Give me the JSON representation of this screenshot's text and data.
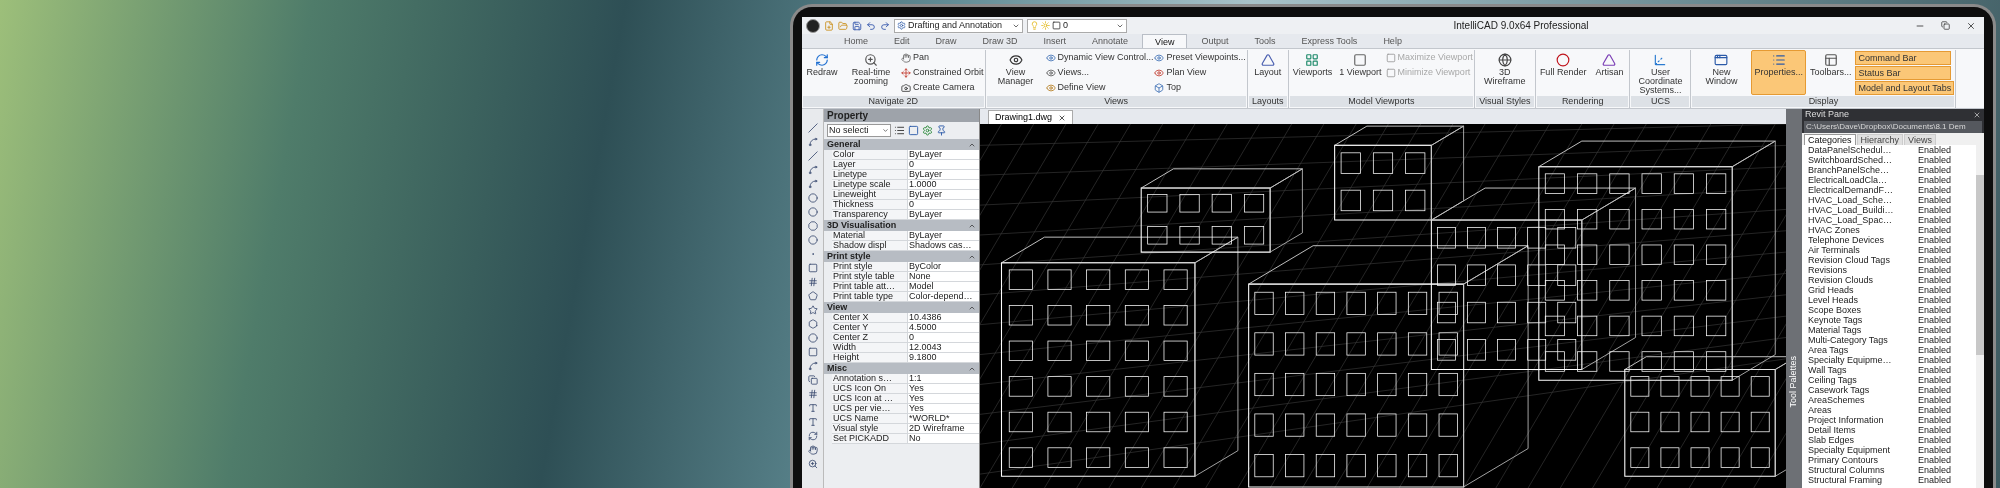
{
  "title_bar": {
    "workspace": "Drafting and Annotation",
    "layer": "0",
    "title": "IntelliCAD 9.0x64 Professional"
  },
  "menu_tabs": [
    {
      "label": "Home",
      "selected": false
    },
    {
      "label": "Edit",
      "selected": false
    },
    {
      "label": "Draw",
      "selected": false
    },
    {
      "label": "Draw 3D",
      "selected": false
    },
    {
      "label": "Insert",
      "selected": false
    },
    {
      "label": "Annotate",
      "selected": false
    },
    {
      "label": "View",
      "selected": true
    },
    {
      "label": "Output",
      "selected": false
    },
    {
      "label": "Tools",
      "selected": false
    },
    {
      "label": "Express Tools",
      "selected": false
    },
    {
      "label": "Help",
      "selected": false
    }
  ],
  "ribbon_groups": [
    {
      "title": "Navigate 2D",
      "items": [
        {
          "kind": "large",
          "label": "Redraw"
        },
        {
          "kind": "large",
          "label": "Real-time zooming"
        },
        {
          "kind": "small",
          "label": "Pan"
        },
        {
          "kind": "small",
          "label": "Constrained Orbit"
        },
        {
          "kind": "small",
          "label": "Create Camera"
        }
      ]
    },
    {
      "title": "Views",
      "items": [
        {
          "kind": "large",
          "label": "View Manager"
        },
        {
          "kind": "small",
          "label": "Dynamic View Control..."
        },
        {
          "kind": "small",
          "label": "Views..."
        },
        {
          "kind": "small",
          "label": "Define View"
        },
        {
          "kind": "small",
          "label": "Preset Viewpoints..."
        },
        {
          "kind": "small",
          "label": "Plan View"
        },
        {
          "kind": "small",
          "label": "Top"
        }
      ]
    },
    {
      "title": "Layouts",
      "items": [
        {
          "kind": "large",
          "label": "Layout"
        }
      ]
    },
    {
      "title": "Model Viewports",
      "items": [
        {
          "kind": "large",
          "label": "Viewports"
        },
        {
          "kind": "large",
          "label": "1 Viewport"
        },
        {
          "kind": "small",
          "label": "Maximize Viewport",
          "disabled": true
        },
        {
          "kind": "small",
          "label": "Minimize Viewport",
          "disabled": true
        }
      ]
    },
    {
      "title": "Visual Styles",
      "items": [
        {
          "kind": "large",
          "label": "3D Wireframe"
        }
      ]
    },
    {
      "title": "Rendering",
      "items": [
        {
          "kind": "large",
          "label": "Full Render"
        },
        {
          "kind": "large",
          "label": "Artisan"
        }
      ]
    },
    {
      "title": "UCS",
      "items": [
        {
          "kind": "large",
          "label": "User Coordinate Systems..."
        }
      ]
    },
    {
      "title": "Display",
      "items": [
        {
          "kind": "large",
          "label": "New Window",
          "selected": false
        },
        {
          "kind": "large",
          "label": "Properties...",
          "selected": true
        },
        {
          "kind": "large",
          "label": "Toolbars...",
          "selected": false
        },
        {
          "kind": "toggle",
          "label": "Command Bar",
          "on": true
        },
        {
          "kind": "toggle",
          "label": "Status Bar",
          "on": true
        },
        {
          "kind": "toggle",
          "label": "Model and Layout Tabs",
          "on": true
        }
      ]
    }
  ],
  "document_tab": "Drawing1.dwg",
  "property_panel": {
    "title": "Property",
    "selection": "No selecti",
    "sections": [
      {
        "title": "General",
        "rows": [
          [
            "Color",
            "ByLayer"
          ],
          [
            "Layer",
            "0"
          ],
          [
            "Linetype",
            "ByLayer"
          ],
          [
            "Linetype scale",
            "1.0000"
          ],
          [
            "Lineweight",
            "ByLayer"
          ],
          [
            "Thickness",
            "0"
          ],
          [
            "Transparency",
            "ByLayer"
          ]
        ]
      },
      {
        "title": "3D Visualisation",
        "rows": [
          [
            "Material",
            "ByLayer"
          ],
          [
            "Shadow displ",
            "Shadows cas…"
          ]
        ]
      },
      {
        "title": "Print style",
        "rows": [
          [
            "Print style",
            "ByColor"
          ],
          [
            "Print style table",
            "None"
          ],
          [
            "Print table att…",
            "Model"
          ],
          [
            "Print table type",
            "Color-depend…"
          ]
        ]
      },
      {
        "title": "View",
        "rows": [
          [
            "Center X",
            "10.4386"
          ],
          [
            "Center Y",
            "4.5000"
          ],
          [
            "Center Z",
            "0"
          ],
          [
            "Width",
            "12.0043"
          ],
          [
            "Height",
            "9.1800"
          ]
        ]
      },
      {
        "title": "Misc",
        "rows": [
          [
            "Annotation s…",
            "1:1"
          ],
          [
            "UCS Icon On",
            "Yes"
          ],
          [
            "UCS Icon at …",
            "Yes"
          ],
          [
            "UCS per vie…",
            "Yes"
          ],
          [
            "UCS Name",
            "*WORLD*"
          ],
          [
            "Visual style",
            "2D Wireframe"
          ],
          [
            "Set PICKADD",
            "No"
          ]
        ]
      }
    ]
  },
  "tool_palettes_label": "Tool Palettes",
  "revit_pane": {
    "title": "Revit Pane",
    "path": "C:\\Users\\Dave\\Dropbox\\Documents\\8.1 Dem",
    "tabs": [
      {
        "label": "Categories",
        "selected": true
      },
      {
        "label": "Hierarchy",
        "selected": false
      },
      {
        "label": "Views",
        "selected": false
      }
    ],
    "rows": [
      [
        "DataPanelSchedul…",
        "Enabled"
      ],
      [
        "SwitchboardSched…",
        "Enabled"
      ],
      [
        "BranchPanelSche…",
        "Enabled"
      ],
      [
        "ElectricalLoadCla…",
        "Enabled"
      ],
      [
        "ElectricalDemandF…",
        "Enabled"
      ],
      [
        "HVAC_Load_Sche…",
        "Enabled"
      ],
      [
        "HVAC_Load_Buildi…",
        "Enabled"
      ],
      [
        "HVAC_Load_Spac…",
        "Enabled"
      ],
      [
        "HVAC Zones",
        "Enabled"
      ],
      [
        "Telephone Devices",
        "Enabled"
      ],
      [
        "Air Terminals",
        "Enabled"
      ],
      [
        "Revision Cloud Tags",
        "Enabled"
      ],
      [
        "Revisions",
        "Enabled"
      ],
      [
        "Revision Clouds",
        "Enabled"
      ],
      [
        "Grid Heads",
        "Enabled"
      ],
      [
        "Level Heads",
        "Enabled"
      ],
      [
        "Scope Boxes",
        "Enabled"
      ],
      [
        "Keynote Tags",
        "Enabled"
      ],
      [
        "Material Tags",
        "Enabled"
      ],
      [
        "Multi-Category Tags",
        "Enabled"
      ],
      [
        "Area Tags",
        "Enabled"
      ],
      [
        "Specialty Equipme…",
        "Enabled"
      ],
      [
        "Wall Tags",
        "Enabled"
      ],
      [
        "Ceiling Tags",
        "Enabled"
      ],
      [
        "Casework Tags",
        "Enabled"
      ],
      [
        "AreaSchemes",
        "Enabled"
      ],
      [
        "Areas",
        "Enabled"
      ],
      [
        "Project Information",
        "Enabled"
      ],
      [
        "Detail Items",
        "Enabled"
      ],
      [
        "Slab Edges",
        "Enabled"
      ],
      [
        "Specialty Equipment",
        "Enabled"
      ],
      [
        "Primary Contours",
        "Enabled"
      ],
      [
        "Structural Columns",
        "Enabled"
      ],
      [
        "Structural Framing",
        "Enabled"
      ]
    ]
  }
}
